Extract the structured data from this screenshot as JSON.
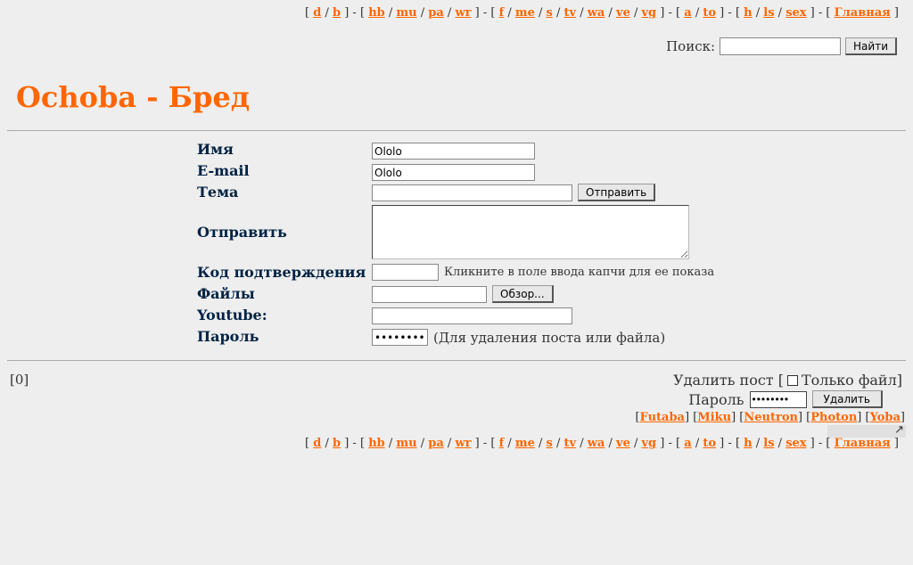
{
  "nav": {
    "groups": [
      [
        "d",
        "b"
      ],
      [
        "hb",
        "mu",
        "pa",
        "wr"
      ],
      [
        "f",
        "me",
        "s",
        "tv",
        "wa",
        "ve",
        "vg"
      ],
      [
        "a",
        "to"
      ],
      [
        "h",
        "ls",
        "sex"
      ],
      [
        "Главная"
      ]
    ]
  },
  "search": {
    "label": "Поиск:",
    "button": "Найти"
  },
  "board": {
    "title": "Ochoba - Бред"
  },
  "form": {
    "name_label": "Имя",
    "name_value": "Ololo",
    "email_label": "E-mail",
    "email_value": "Ololo",
    "subject_label": "Тема",
    "submit_button": "Отправить",
    "message_label": "Отправить",
    "captcha_label": "Код подтверждения",
    "captcha_hint": "Кликните в поле ввода капчи для ее показа",
    "files_label": "Файлы",
    "browse_button": "Обзор...",
    "youtube_label": "Youtube:",
    "password_label": "Пароль",
    "password_value": "••••••••",
    "password_hint": "(Для удаления поста или файла)"
  },
  "footer": {
    "page_count": "[0]",
    "delete_label": "Удалить пост [",
    "only_file_label": "Только файл]",
    "password_label": "Пароль",
    "password_value": "••••••••",
    "delete_button": "Удалить",
    "styles": [
      "Futaba",
      "Miku",
      "Neutron",
      "Photon",
      "Yoba"
    ],
    "corner_glyph": "↗"
  },
  "colors": {
    "accent": "#ff6600",
    "label": "#002244",
    "background": "#eeeeee"
  }
}
